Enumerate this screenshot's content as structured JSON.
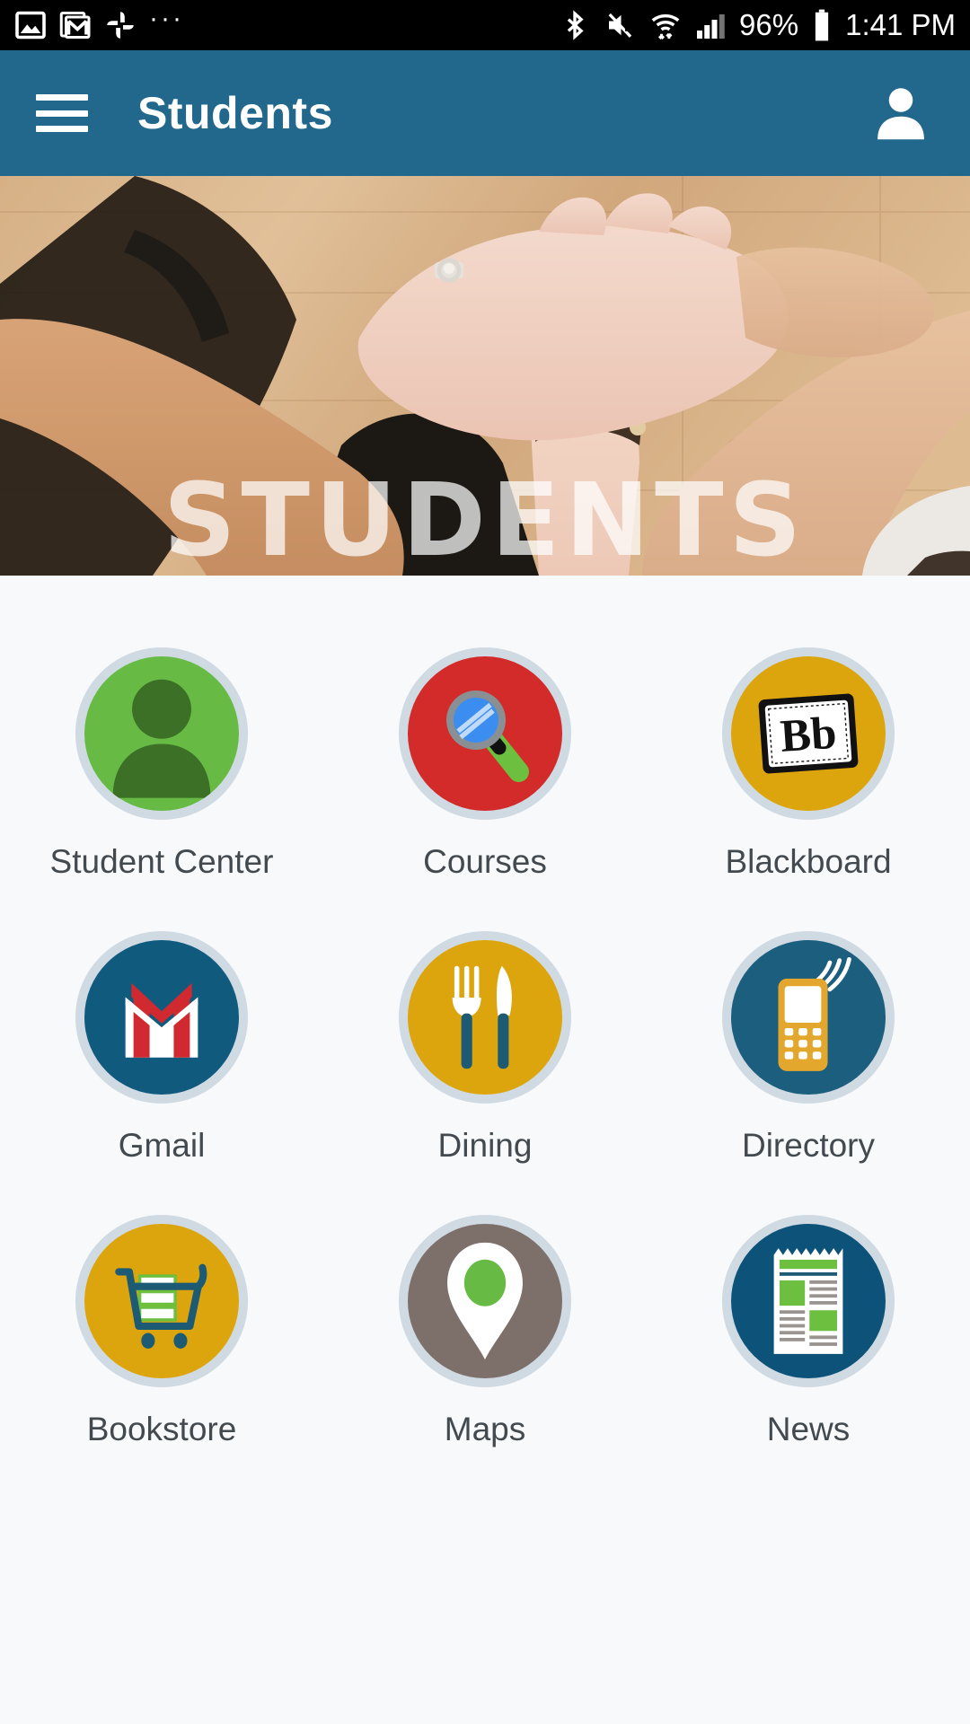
{
  "statusbar": {
    "left_icons": [
      "photo-icon",
      "gmail-icon",
      "google-photos-icon",
      "overflow-dots-icon"
    ],
    "right_icons": [
      "bluetooth-icon",
      "mute-icon",
      "wifi-icon",
      "signal-icon",
      "battery-icon"
    ],
    "battery_percent": "96%",
    "time": "1:41 PM"
  },
  "appbar": {
    "menu_icon": "hamburger-menu-icon",
    "title": "Students",
    "account_icon": "account-person-icon",
    "background_color": "#22678c"
  },
  "hero": {
    "overlay_text": "STUDENTS",
    "description": "hands stacked together over wooden table"
  },
  "grid": {
    "tiles": [
      {
        "label": "Student Center",
        "icon": "person-silhouette-icon",
        "color": "#67bb45",
        "ring": "#cfdae3"
      },
      {
        "label": "Courses",
        "icon": "magnifying-glass-icon",
        "color": "#d32a2a",
        "ring": "#cfdae3"
      },
      {
        "label": "Blackboard",
        "icon": "blackboard-bb-icon",
        "color": "#dda50d",
        "ring": "#cfdae3"
      },
      {
        "label": "Gmail",
        "icon": "gmail-envelope-icon",
        "color": "#105a7e",
        "ring": "#cfdae3"
      },
      {
        "label": "Dining",
        "icon": "fork-knife-icon",
        "color": "#dda50d",
        "ring": "#cfdae3"
      },
      {
        "label": "Directory",
        "icon": "phone-signal-icon",
        "color": "#1c5e7d",
        "ring": "#cfdae3"
      },
      {
        "label": "Bookstore",
        "icon": "shopping-cart-books-icon",
        "color": "#dda50d",
        "ring": "#cfdae3"
      },
      {
        "label": "Maps",
        "icon": "map-pin-icon",
        "color": "#7d706b",
        "ring": "#cfdae3"
      },
      {
        "label": "News",
        "icon": "newspaper-icon",
        "color": "#0d5379",
        "ring": "#cfdae3"
      }
    ]
  },
  "colors": {
    "accent_teal": "#22678c",
    "page_background": "#f7f9fb",
    "label_text": "#434a4f"
  }
}
